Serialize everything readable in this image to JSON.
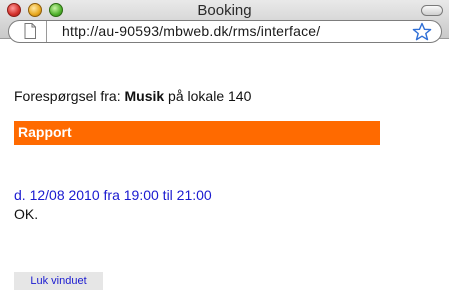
{
  "window": {
    "title": "Booking"
  },
  "urlbar": {
    "url": "http://au-90593/mbweb.dk/rms/interface/"
  },
  "content": {
    "request_prefix": "Forespørgsel fra: ",
    "request_name": "Musik",
    "request_suffix": " på lokale 140",
    "report_title": "Rapport",
    "date_line": "d. 12/08 2010 fra 19:00 til 21:00",
    "status_text": "OK.",
    "close_button_label": "Luk vinduet"
  },
  "colors": {
    "report_bar": "#ff6a00",
    "link_blue": "#1a1ad0"
  },
  "icons": {
    "page": "page-icon",
    "bookmark": "star-icon"
  }
}
